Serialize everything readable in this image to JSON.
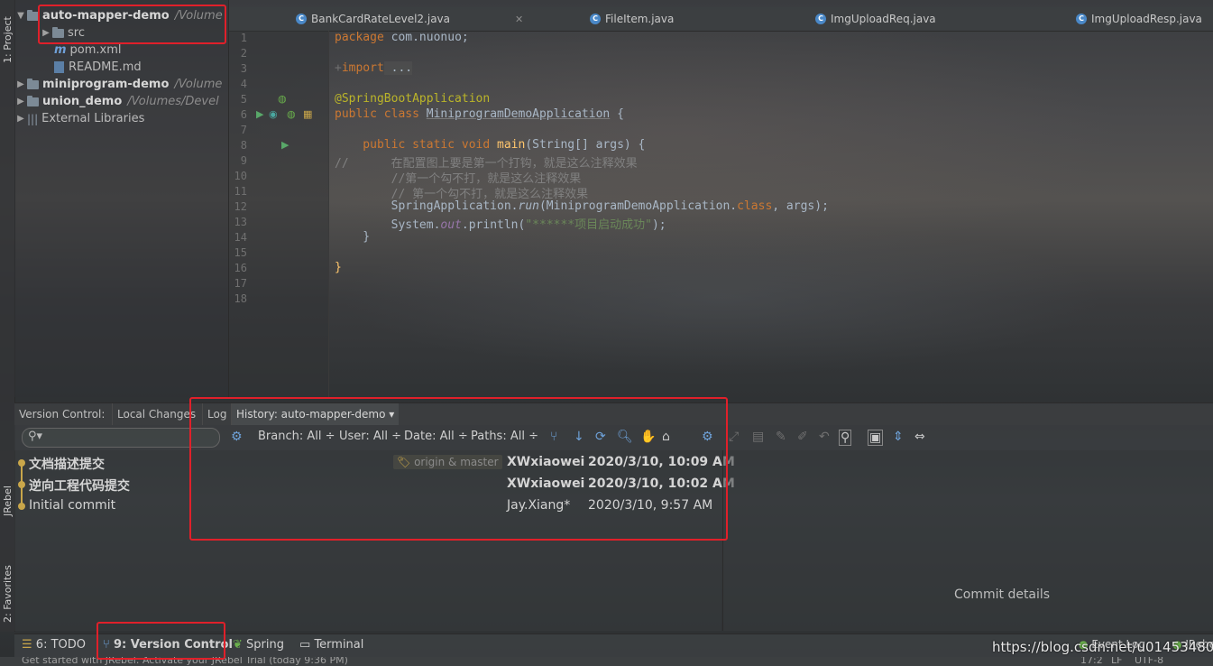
{
  "sidebar_left": {
    "project_tab": "1: Project",
    "jrebel_tab": "JRebel",
    "favorites_tab": "2: Favorites"
  },
  "project_tree": {
    "items": [
      {
        "name": "auto-mapper-demo",
        "path": "/Volume"
      },
      {
        "name": "src"
      },
      {
        "name": "pom.xml"
      },
      {
        "name": "README.md"
      },
      {
        "name": "miniprogram-demo",
        "path": "/Volume"
      },
      {
        "name": "union_demo",
        "path": "/Volumes/Devel"
      },
      {
        "name": "External Libraries"
      }
    ]
  },
  "editor": {
    "tabs": [
      "BankCardRateLevel2.java",
      "FileItem.java",
      "ImgUploadReq.java",
      "ImgUploadResp.java"
    ],
    "line_numbers": [
      "1",
      "2",
      "3",
      "4",
      "5",
      "6",
      "7",
      "8",
      "9",
      "10",
      "11",
      "12",
      "13",
      "14",
      "15",
      "16",
      "17",
      "18"
    ],
    "code": {
      "l1_kw": "package",
      "l1_rest": " com.nuonuo;",
      "l3_kw": "import",
      "l3_rest": " ...",
      "l6": "@SpringBootApplication",
      "l7_kw": "public class",
      "l7_name": "MiniprogramDemoApplication",
      "l7_rest": " {",
      "l9_kw": "    public static void",
      "l9_fn": " main",
      "l9_rest": "(String[] args) {",
      "l10": "//      在配置图上要是第一个打钩，就是这么注释效果",
      "l11": "        //第一个勾不打，就是这么注释效果",
      "l12": "        // 第一个勾不打，就是这么注释效果",
      "l13_a": "        SpringApplication.",
      "l13_b": "run",
      "l13_c": "(MiniprogramDemoApplication.",
      "l13_d": "class",
      "l13_e": ", args);",
      "l14_a": "        System.",
      "l14_b": "out",
      "l14_c": ".println(",
      "l14_d": "\"******项目启动成功\"",
      "l14_e": ");",
      "l15": "    }",
      "l17": "}"
    }
  },
  "version_control": {
    "tabs": [
      "Version Control:",
      "Local Changes",
      "Log",
      "History: auto-mapper-demo ▾"
    ],
    "filters": {
      "branch": "Branch: All ÷",
      "user": "User: All ÷",
      "date": "Date: All ÷",
      "paths": "Paths: All ÷"
    },
    "commits": [
      {
        "message": "文档描述提交",
        "tag": "origin & master",
        "author": "XWxiaowei",
        "date": "2020/3/10, 10:09 AM"
      },
      {
        "message": "逆向工程代码提交",
        "tag": "",
        "author": "XWxiaowei",
        "date": "2020/3/10, 10:02 AM"
      },
      {
        "message": "Initial commit",
        "tag": "",
        "author": "Jay.Xiang*",
        "date": "2020/3/10, 9:57 AM"
      }
    ],
    "details_label": "Commit details"
  },
  "bottom_tools": {
    "todo": "6: TODO",
    "version_control": "9: Version Control",
    "spring": "Spring",
    "terminal": "Terminal",
    "event_log": "Event Log",
    "jrebel": "JRebel"
  },
  "status": {
    "text": "Get started with JRebel: Activate your JRebel Trial (today 9:36 PM)",
    "position": "17:2",
    "line_sep": "LF",
    "encoding": "UTF-8"
  },
  "watermark": "https://blog.csdn.net/u014534808",
  "colors": {
    "highlight_box": "#e0202a",
    "keyword": "#cc7832",
    "annotation": "#bbb529",
    "string": "#6a8759",
    "comment": "#808080"
  }
}
